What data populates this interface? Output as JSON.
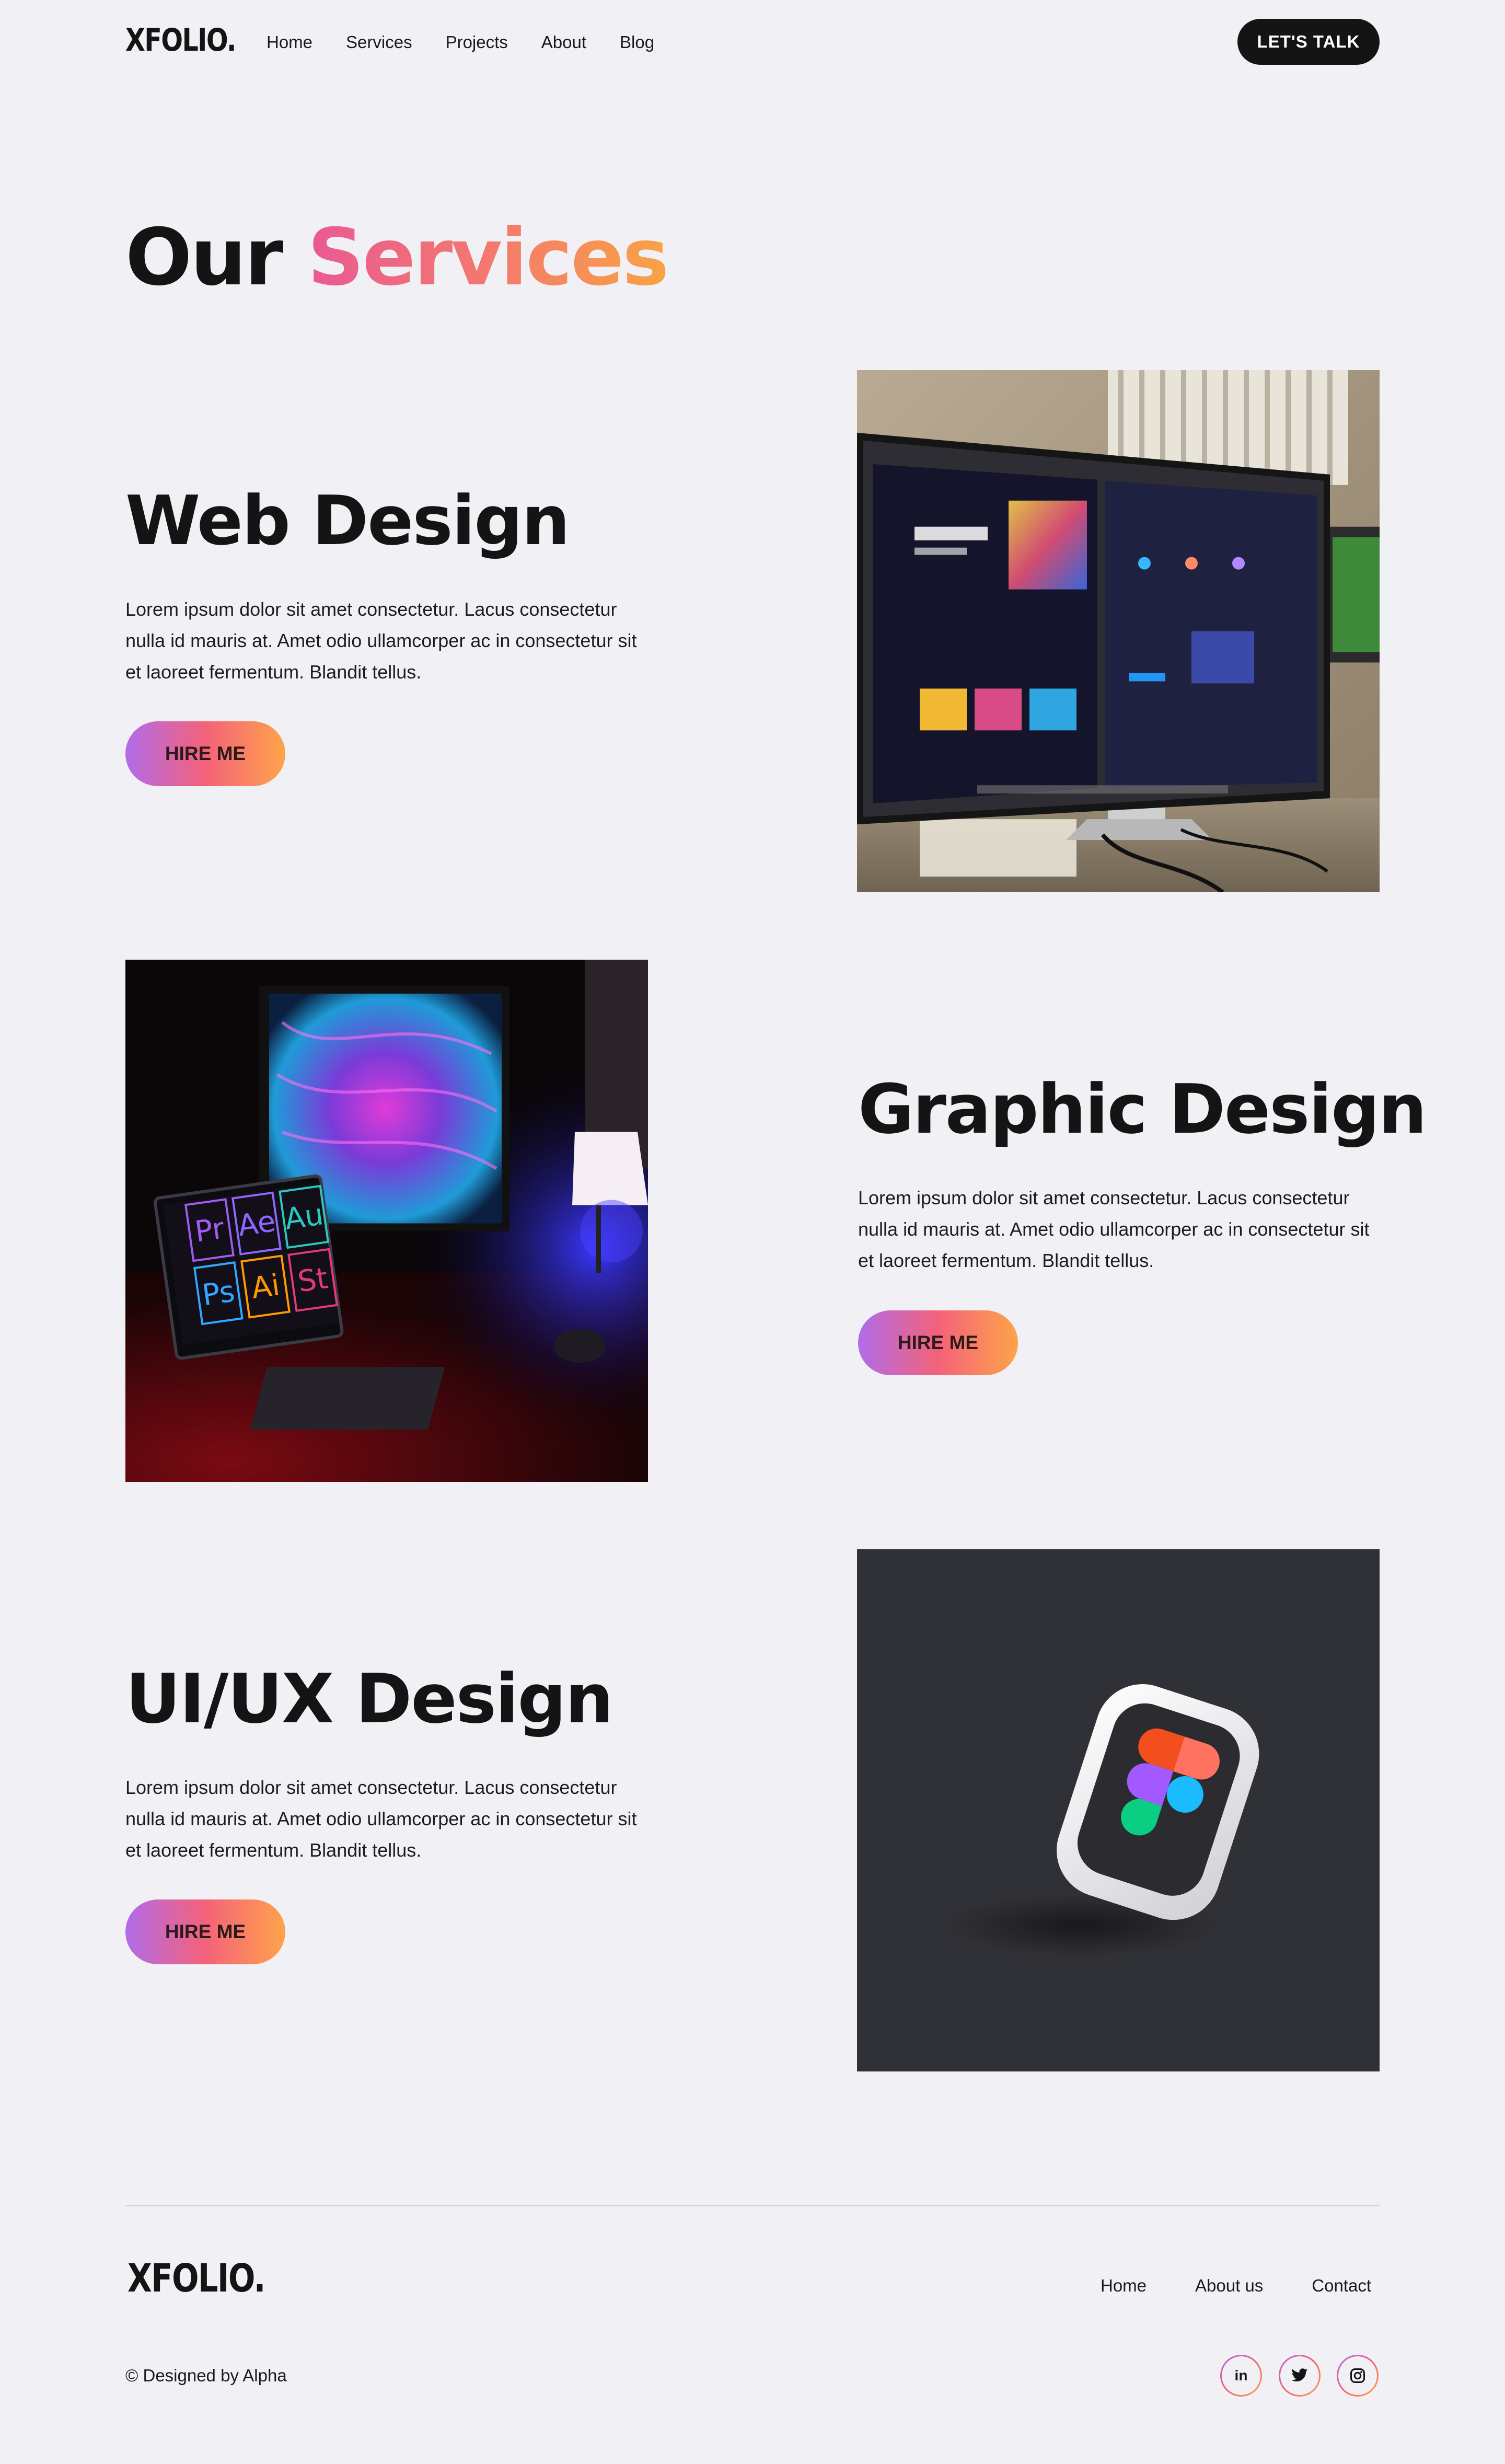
{
  "header": {
    "logo": "XFOLIO.",
    "nav": [
      "Home",
      "Services",
      "Projects",
      "About",
      "Blog"
    ],
    "cta_label": "LET'S TALK"
  },
  "hero": {
    "title_prefix": "Our",
    "title_highlight": "Services"
  },
  "services": [
    {
      "title": "Web Design",
      "description": "Lorem ipsum dolor sit amet consectetur. Lacus consectetur nulla id mauris at. Amet odio ullamcorper ac in consectetur sit et laoreet fermentum. Blandit tellus.",
      "button_label": "HIRE ME",
      "image": "monitor-web-design-image"
    },
    {
      "title": "Graphic Design",
      "description": "Lorem ipsum dolor sit amet consectetur. Lacus consectetur nulla id mauris at. Amet odio ullamcorper ac in consectetur sit et laoreet fermentum. Blandit tellus.",
      "button_label": "HIRE ME",
      "image": "adobe-apps-desk-image",
      "app_icons": [
        "Pr",
        "Ae",
        "Au",
        "Ps",
        "Ai",
        "St"
      ]
    },
    {
      "title": "UI/UX Design",
      "description": "Lorem ipsum dolor sit amet consectetur. Lacus consectetur nulla id mauris at. Amet odio ullamcorper ac in consectetur sit et laoreet fermentum. Blandit tellus.",
      "button_label": "HIRE ME",
      "image": "figma-3d-icon-image"
    }
  ],
  "footer": {
    "logo": "XFOLIO.",
    "links": [
      "Home",
      "About us",
      "Contact"
    ],
    "copyright": "© Designed by Alpha",
    "social": [
      "linkedin-icon",
      "twitter-icon",
      "instagram-icon"
    ],
    "linkedin_text": "in"
  },
  "colors": {
    "background": "#f1f1f5",
    "text": "#141414",
    "gradient_start": "#b06ce9",
    "gradient_mid": "#f4627a",
    "gradient_end": "#fea34a"
  }
}
